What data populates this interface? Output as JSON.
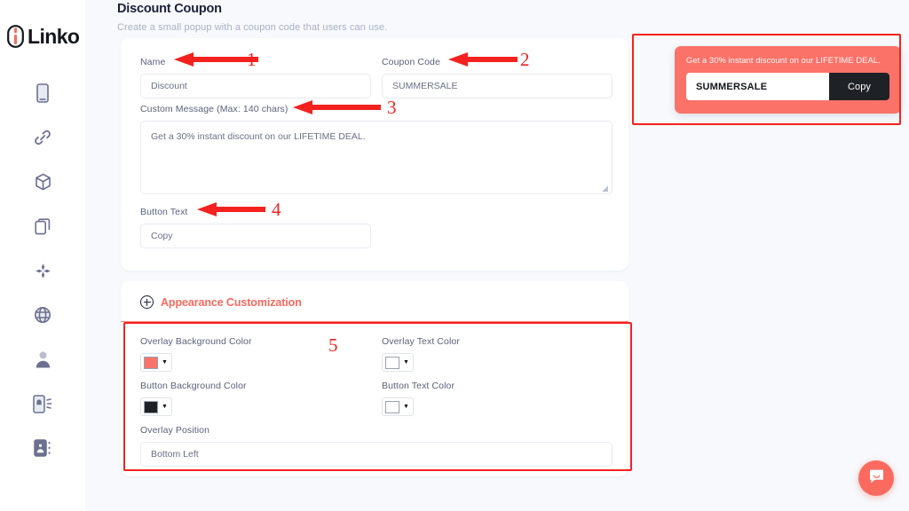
{
  "brand": {
    "name": "Linko",
    "logo_icon": "link-chain-icon",
    "accent_color": "#FA6A5F"
  },
  "sidebar": {
    "items": [
      {
        "icon": "mobile-device-icon",
        "name": "sidebar-item-devices"
      },
      {
        "icon": "link-chain-icon",
        "name": "sidebar-item-links"
      },
      {
        "icon": "cube-box-icon",
        "name": "sidebar-item-products"
      },
      {
        "icon": "copy-duplicate-icon",
        "name": "sidebar-item-pages"
      },
      {
        "icon": "sparkle-move-icon",
        "name": "sidebar-item-effects"
      },
      {
        "icon": "globe-grid-icon",
        "name": "sidebar-item-domains"
      },
      {
        "icon": "user-profile-icon",
        "name": "sidebar-item-account"
      },
      {
        "icon": "phone-notification-icon",
        "name": "sidebar-item-notifications"
      },
      {
        "icon": "contact-card-icon",
        "name": "sidebar-item-contacts"
      }
    ]
  },
  "header": {
    "title_strong": "Discount",
    "title_light": "Coupon",
    "subtitle": "Create a small popup with a coupon code that users can use."
  },
  "form": {
    "name": {
      "label": "Name",
      "value": "Discount"
    },
    "coupon_code": {
      "label": "Coupon Code",
      "value": "SUMMERSALE"
    },
    "custom_message": {
      "label": "Custom Message (Max: 140 chars)",
      "value": "Get a 30% instant discount on our LIFETIME DEAL."
    },
    "button_text": {
      "label": "Button Text",
      "value": "Copy"
    }
  },
  "appearance": {
    "section_title": "Appearance Customization",
    "expand_icon": "plus-circle-icon",
    "overlay_background_color": {
      "label": "Overlay Background Color",
      "value": "#FA7268"
    },
    "overlay_text_color": {
      "label": "Overlay Text Color",
      "value": "#FFFFFF"
    },
    "button_background_color": {
      "label": "Button Background Color",
      "value": "#1E2125"
    },
    "button_text_color": {
      "label": "Button Text Color",
      "value": "#FFFFFF"
    },
    "overlay_position": {
      "label": "Overlay Position",
      "value": "Bottom Left"
    }
  },
  "preview": {
    "message": "Get a 30% instant discount on our LIFETIME DEAL.",
    "code": "SUMMERSALE",
    "button_label": "Copy",
    "background_color": "#FA7268",
    "button_background_color": "#1E2125"
  },
  "annotations": {
    "color": "#F4221F",
    "markers": [
      {
        "number": "1",
        "target": "name-label"
      },
      {
        "number": "2",
        "target": "coupon-code-label"
      },
      {
        "number": "3",
        "target": "custom-message-label"
      },
      {
        "number": "4",
        "target": "button-text-label"
      },
      {
        "number": "5",
        "target": "appearance-section"
      }
    ]
  },
  "chat": {
    "icon": "chat-bubble-icon",
    "color": "#FA6A5F"
  }
}
